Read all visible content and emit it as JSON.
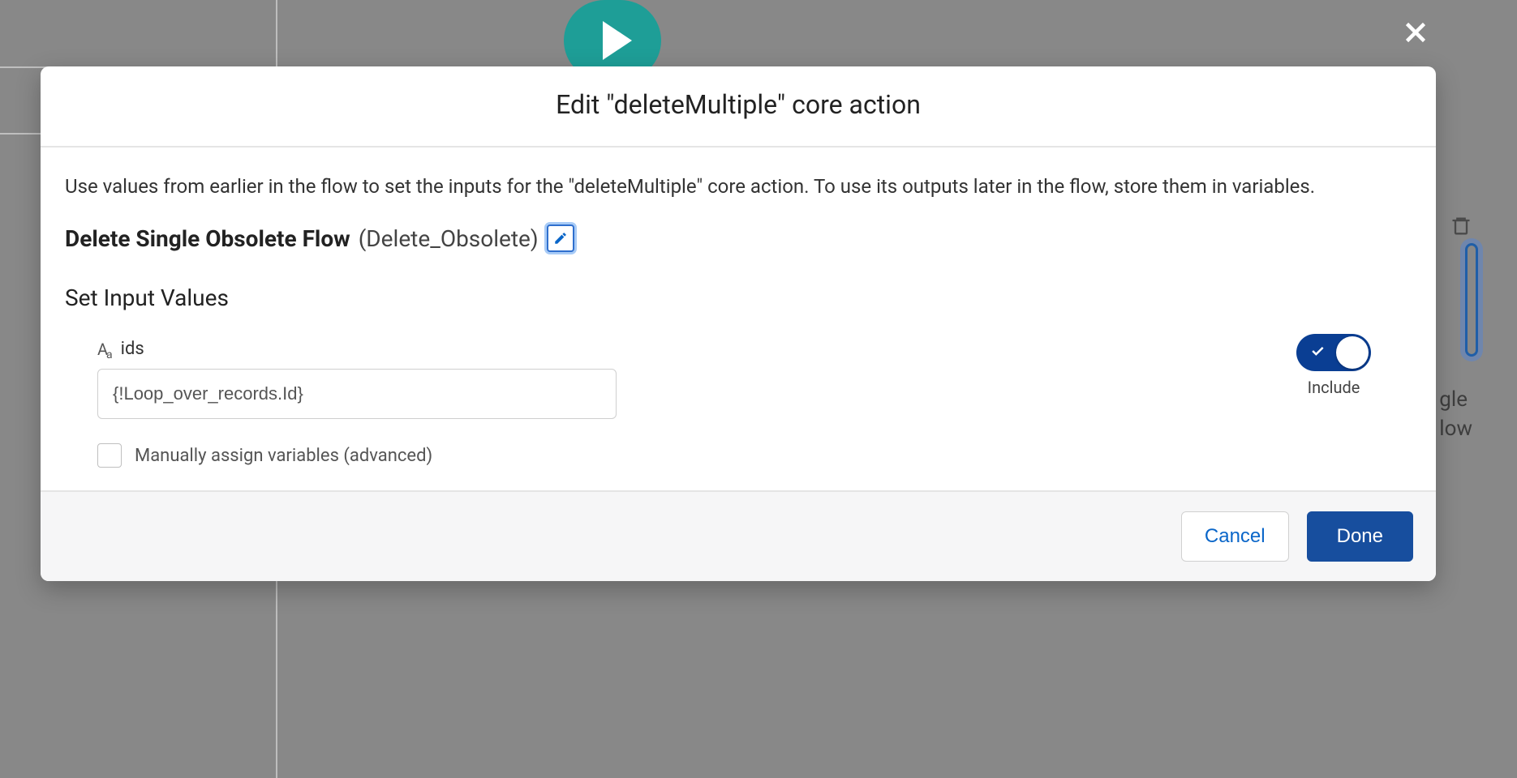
{
  "close_icon_name": "close",
  "background": {
    "node_text_line1": "gle",
    "node_text_line2": "low"
  },
  "modal": {
    "title": "Edit \"deleteMultiple\" core action",
    "intro": "Use values from earlier in the flow to set the inputs for the \"deleteMultiple\" core action. To use its outputs later in the flow, store them in variables.",
    "element_label": "Delete Single Obsolete Flow",
    "element_api": "(Delete_Obsolete)",
    "section_heading": "Set Input Values",
    "input": {
      "label": "ids",
      "value": "{!Loop_over_records.Id}",
      "toggle_label": "Include",
      "toggle_on": true
    },
    "advanced_checkbox_label": "Manually assign variables (advanced)",
    "buttons": {
      "cancel": "Cancel",
      "done": "Done"
    }
  }
}
